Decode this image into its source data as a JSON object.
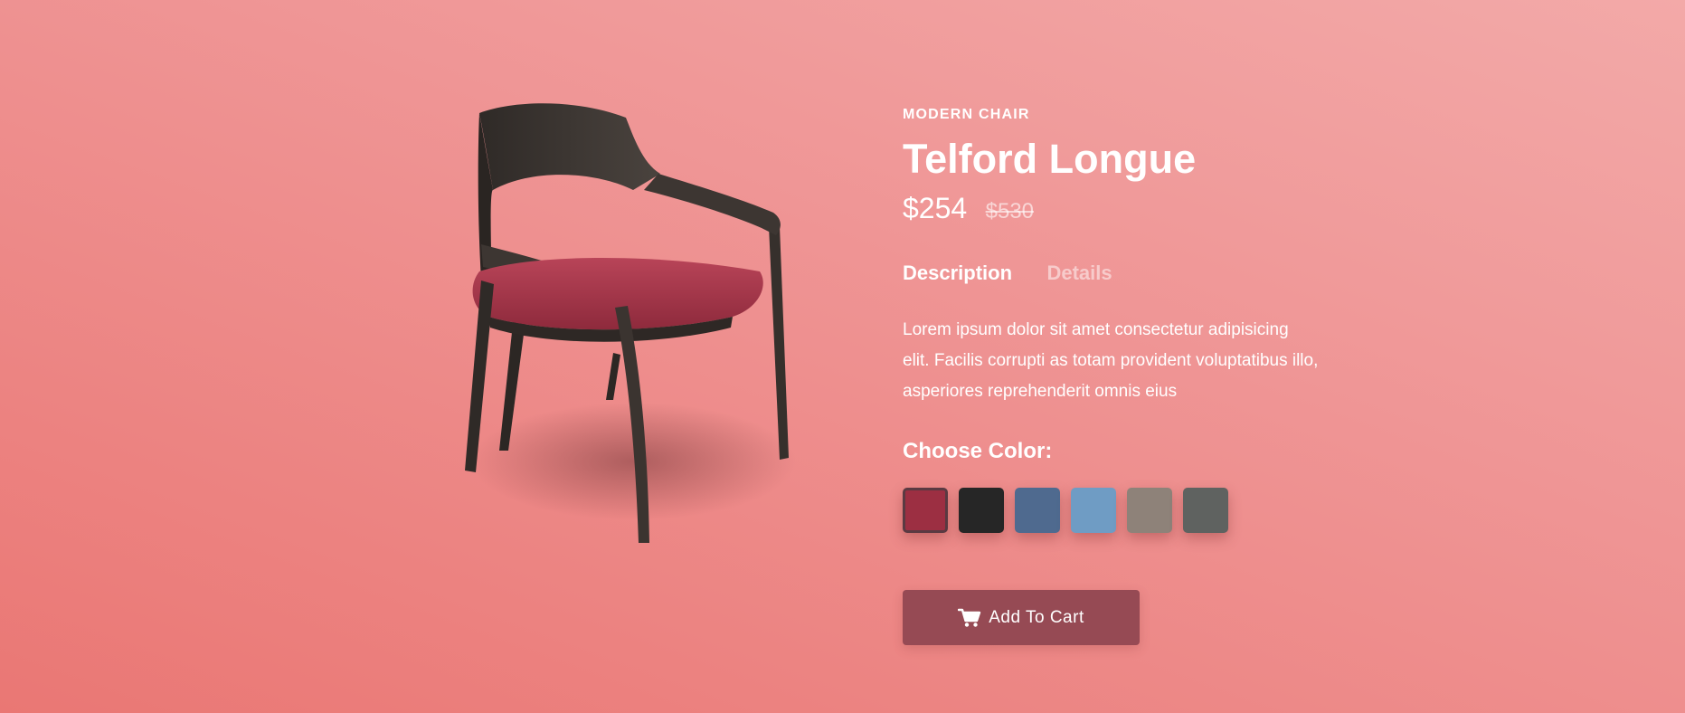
{
  "product": {
    "category": "MODERN CHAIR",
    "title": "Telford Longue",
    "price": "$254",
    "old_price": "$530",
    "description": "Lorem ipsum dolor sit amet consectetur adipisicing elit. Facilis corrupti as totam provident voluptatibus illo, asperiores reprehenderit omnis eius"
  },
  "tabs": [
    {
      "label": "Description",
      "active": true
    },
    {
      "label": "Details",
      "active": false
    }
  ],
  "color_picker": {
    "label": "Choose Color:",
    "swatches": [
      {
        "color": "#9c2f42",
        "selected": true
      },
      {
        "color": "#262626",
        "selected": false
      },
      {
        "color": "#4f6a8f",
        "selected": false
      },
      {
        "color": "#6f9cc4",
        "selected": false
      },
      {
        "color": "#8e8279",
        "selected": false
      },
      {
        "color": "#5f6260",
        "selected": false
      }
    ]
  },
  "cart_button": {
    "label": "Add To Cart",
    "icon": "cart-icon"
  },
  "colors": {
    "button_bg": "#964a54",
    "chair_wood": "#3a3430",
    "chair_seat": "#a8384e"
  }
}
